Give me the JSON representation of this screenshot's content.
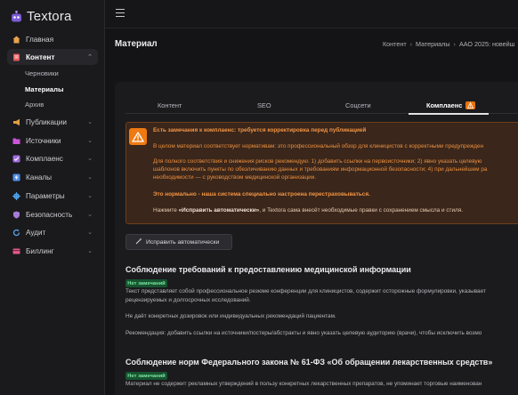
{
  "app": {
    "name": "Textora"
  },
  "sidebar": {
    "items": [
      {
        "label": "Главная",
        "icon": "home-icon",
        "color": "#e8a34a"
      },
      {
        "label": "Контент",
        "icon": "document-icon",
        "color": "#e25b5b",
        "expanded": true
      },
      {
        "label": "Публикации",
        "icon": "megaphone-icon",
        "color": "#e0a043"
      },
      {
        "label": "Источники",
        "icon": "folder-icon",
        "color": "#c955d6"
      },
      {
        "label": "Комплаенс",
        "icon": "check-icon",
        "color": "#9f6bdf"
      },
      {
        "label": "Каналы",
        "icon": "bolt-icon",
        "color": "#4f8fe6"
      },
      {
        "label": "Параметры",
        "icon": "gear-icon",
        "color": "#4fa0e6"
      },
      {
        "label": "Безопасность",
        "icon": "shield-icon",
        "color": "#a97bd9"
      },
      {
        "label": "Аудит",
        "icon": "refresh-icon",
        "color": "#58a3e8"
      },
      {
        "label": "Биллинг",
        "icon": "card-icon",
        "color": "#e25b8a"
      }
    ],
    "content_sub": [
      "Черновики",
      "Материалы",
      "Архив"
    ]
  },
  "page": {
    "title": "Материал",
    "breadcrumb": [
      "Контент",
      "Материалы",
      "ААО 2025: новейш"
    ]
  },
  "tabs": [
    "Контент",
    "SEO",
    "Соцсети",
    "Комплаенс"
  ],
  "alert": {
    "title": "Есть замечания к комплаенс: требуется корректировка перед публикацией",
    "p1": "В целом материал соответствует нормативам: это профессиональный обзор для клиницистов с корректными предупрежден",
    "p2_l1": "Для полного соответствия и снижения рисков рекомендую: 1) добавить ссылки на первоисточники; 2) явно указать целевую",
    "p2_l2": "шаблонов включить пункты по обезличиванию данных и требованиям информационной безопасности; 4) при дальнейшем ра",
    "p2_l3": "необходимости — с руководством медицинской организации.",
    "note": "Это нормально - наша система специально настроена перестраховываться.",
    "hint_prefix": "Нажмите ",
    "hint_bold": "«Исправить автоматически»",
    "hint_suffix": ", и Textora сама внесёт необходимые правки с сохранением смысла и стиля."
  },
  "fix_button": "Исправить автоматически",
  "sections": [
    {
      "title": "Соблюдение требований к предоставлению медицинской информации",
      "badge": "Нет замечаний",
      "lines": [
        "Текст представляет собой профессиональное резюме конференции для клиницистов, содержит осторожные формулировки, указывает",
        "рецензируемых и долгосрочных исследований.",
        "Не даёт конкретных дозировок или индивидуальных рекомендаций пациентам.",
        "Рекомендация: добавить ссылки на источники/постеры/абстракты и явно указать целевую аудиторию (врачи), чтобы исключить возмо"
      ]
    },
    {
      "title": "Соблюдение норм Федерального закона № 61-ФЗ «Об обращении лекарственных средств»",
      "badge": "Нет замечаний",
      "lines": [
        "Материал не содержит рекламных утверждений в пользу конкретных лекарственных препаратов, не упоминает торговые наименован"
      ]
    }
  ],
  "colors": {
    "accent": "#ef7a12",
    "ok": "#15542f",
    "alert_bg": "#3a261a"
  }
}
